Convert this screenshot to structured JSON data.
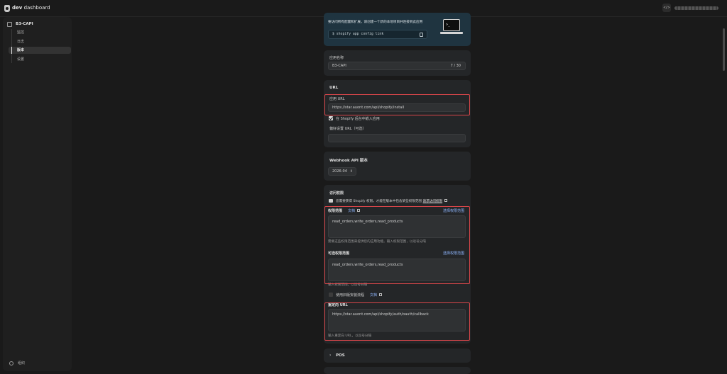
{
  "topbar": {
    "brand_bold": "dev",
    "brand_rest": "dashboard",
    "code_icon": "</>"
  },
  "sidebar": {
    "app_name": "B3-CAPI",
    "items": [
      {
        "label": "监控"
      },
      {
        "label": "日志"
      },
      {
        "label": "版本"
      },
      {
        "label": "设置"
      }
    ],
    "bottom_label": "组织"
  },
  "cli_card": {
    "hint": "要访问所有配置和扩展，请创建一个新的本地项目并连接到此应用",
    "command": "shopify app config link"
  },
  "app_name_card": {
    "label": "应用名称",
    "value": "B3-CAPI",
    "count": "7 / 30"
  },
  "url_card": {
    "title": "URL",
    "app_url_label": "应用 URL",
    "app_url_value": "https://star.auont.com/api/shopify/install",
    "embed_label": "在 Shopify 后台中嵌入应用",
    "pref_url_label": "偏好设置 URL（可选）",
    "pref_url_value": ""
  },
  "webhook_card": {
    "title": "Webhook API 版本",
    "version": "2026-04"
  },
  "access_card": {
    "title": "访问权限",
    "notice": "您需要获得 Shopify 权限，才能在版本中包含某些权限范围",
    "notice_link": "请求访问权限",
    "scopes_label": "权限范围",
    "docs_label": "文档",
    "select_scopes": "选择权限范围",
    "scopes_value": "read_orders,write_orders,read_products",
    "scopes_help": "需要这些权限范围来提供您的应用功能。输入权限范围，以逗号分隔",
    "optional_label": "可选权限范围",
    "optional_select": "选择权限范围",
    "optional_value": "read_orders,write_orders,read_products",
    "optional_help": "输入权限范围，以逗号分隔",
    "legacy_label": "使用旧版安装流程",
    "legacy_docs": "文档",
    "redirect_label": "重定向 URL",
    "redirect_value": "https://star.auont.com/api/shopify/auth/oauth/callback",
    "redirect_help": "输入重定向 URL，以逗号分隔"
  },
  "pos_card": {
    "title": "POS"
  },
  "colors": {
    "highlight": "#d9464a",
    "link": "#8fb7ff",
    "cli_bg": "#1f3440"
  }
}
